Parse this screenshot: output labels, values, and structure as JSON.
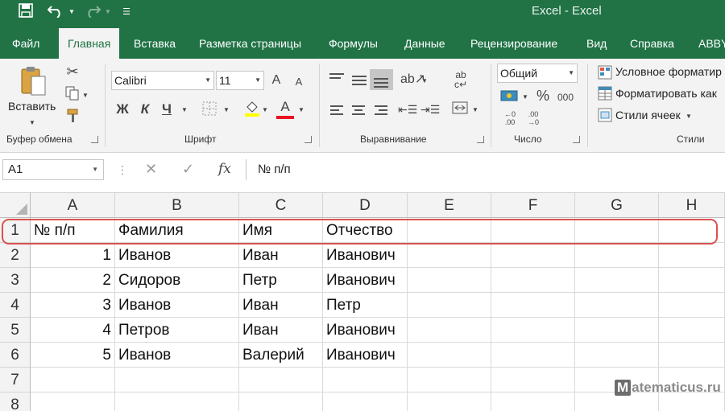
{
  "title_bar": {
    "save_icon": "save-icon",
    "undo_icon": "undo-icon",
    "redo_icon": "redo-icon",
    "customize_icon": "customize-qat-icon",
    "title": "Excel  -  Excel"
  },
  "tabs": [
    "Файл",
    "Главная",
    "Вставка",
    "Разметка страницы",
    "Формулы",
    "Данные",
    "Рецензирование",
    "Вид",
    "Справка",
    "ABBY"
  ],
  "active_tab": "Главная",
  "ribbon": {
    "clipboard": {
      "label": "Буфер обмена",
      "paste": "Вставить"
    },
    "font": {
      "label": "Шрифт",
      "name": "Calibri",
      "size": "11",
      "bold": "Ж",
      "italic": "К",
      "underline": "Ч",
      "grow": "A",
      "shrink": "A",
      "font_color_letter": "A",
      "font_color": "#e81123",
      "fill_color": "#ffff00"
    },
    "alignment": {
      "label": "Выравнивание"
    },
    "number": {
      "label": "Число",
      "format": "Общий",
      "percent": "%",
      "thousands": "000"
    },
    "styles": {
      "label": "Стили",
      "conditional": "Условное форматир",
      "as_table": "Форматировать как",
      "cell_styles": "Стили ячеек"
    }
  },
  "formula_bar": {
    "name_box": "A1",
    "fx": "fx",
    "content": "№ п/п"
  },
  "columns": [
    "A",
    "B",
    "C",
    "D",
    "E",
    "F",
    "G",
    "H"
  ],
  "rows": [
    {
      "num": "1",
      "cells": [
        "№ п/п",
        "Фамилия",
        "Имя",
        "Отчество",
        "",
        "",
        "",
        ""
      ]
    },
    {
      "num": "2",
      "cells": [
        "1",
        "Иванов",
        "Иван",
        "Иванович",
        "",
        "",
        "",
        ""
      ]
    },
    {
      "num": "3",
      "cells": [
        "2",
        "Сидоров",
        "Петр",
        "Иванович",
        "",
        "",
        "",
        ""
      ]
    },
    {
      "num": "4",
      "cells": [
        "3",
        "Иванов",
        "Иван",
        "Петр",
        "",
        "",
        "",
        ""
      ]
    },
    {
      "num": "5",
      "cells": [
        "4",
        "Петров",
        "Иван",
        "Иванович",
        "",
        "",
        "",
        ""
      ]
    },
    {
      "num": "6",
      "cells": [
        "5",
        "Иванов",
        "Валерий",
        "Иванович",
        "",
        "",
        "",
        ""
      ]
    },
    {
      "num": "7",
      "cells": [
        "",
        "",
        "",
        "",
        "",
        "",
        "",
        ""
      ]
    },
    {
      "num": "8",
      "cells": [
        "",
        "",
        "",
        "",
        "",
        "",
        "",
        ""
      ]
    }
  ],
  "colors": {
    "excel_green": "#217346",
    "highlight": "#d9534f"
  },
  "watermark": {
    "letter": "M",
    "text": "atematicus.ru"
  }
}
